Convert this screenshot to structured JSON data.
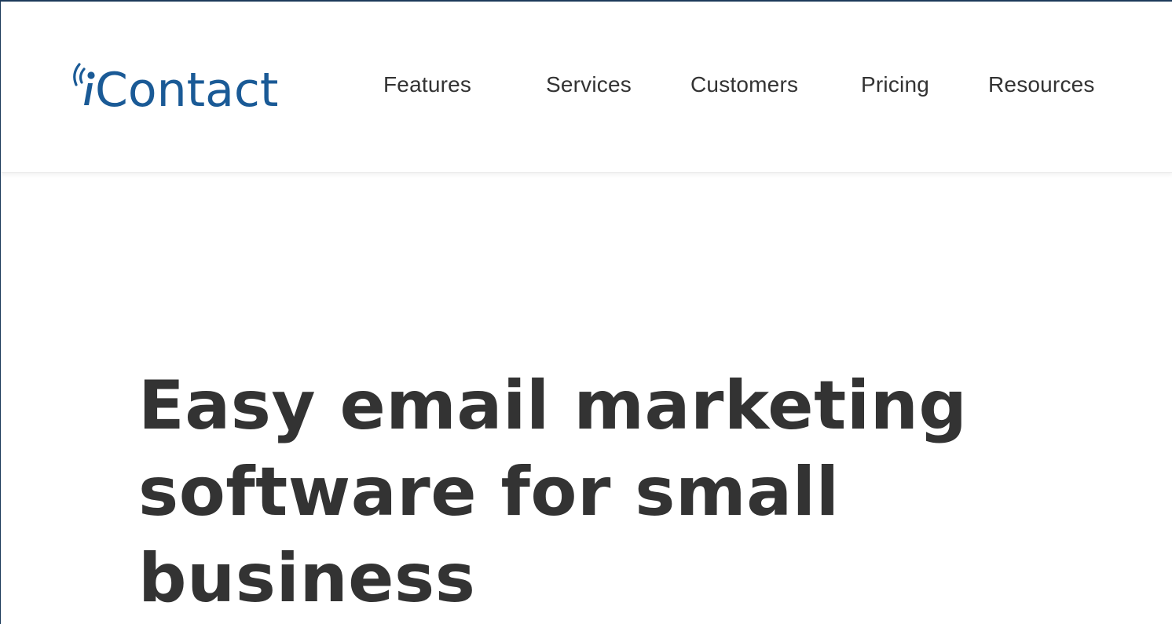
{
  "header": {
    "logo_text": "iContact",
    "logo_color": "#1a5a96",
    "nav": [
      {
        "label": "Features"
      },
      {
        "label": "Services"
      },
      {
        "label": "Customers"
      },
      {
        "label": "Pricing"
      },
      {
        "label": "Resources"
      }
    ]
  },
  "hero": {
    "title_lines": [
      "Easy email marketing",
      "software for small",
      "business"
    ],
    "text_color": "#333333"
  }
}
